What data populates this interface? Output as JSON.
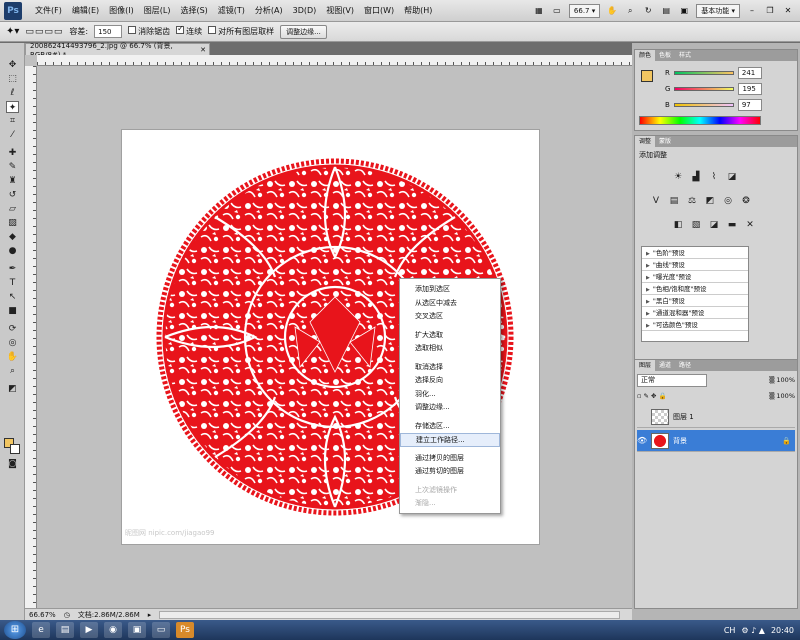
{
  "menubar": {
    "logo": "Ps",
    "items": [
      "文件(F)",
      "编辑(E)",
      "图像(I)",
      "图层(L)",
      "选择(S)",
      "滤镜(T)",
      "分析(A)",
      "3D(D)",
      "视图(V)",
      "窗口(W)",
      "帮助(H)"
    ],
    "zoom": "66.7",
    "workspace": "基本功能"
  },
  "options": {
    "tolerance_label": "容差:",
    "tolerance_value": "150",
    "antialias_label": "消除锯齿",
    "contiguous_label": "连续",
    "sample_all_label": "对所有图层取样",
    "refine_edge_button": "调整边缘..."
  },
  "document": {
    "tab_title": "200862414493796_2.jpg @ 66.7% (背景, RGB/8#) *",
    "watermark": "昵图网 nipic.com/jiagao99"
  },
  "context_menu": {
    "items": [
      {
        "label": "添加到选区",
        "state": "normal"
      },
      {
        "label": "从选区中减去",
        "state": "normal"
      },
      {
        "label": "交叉选区",
        "state": "normal"
      },
      {
        "label": "",
        "state": "sep"
      },
      {
        "label": "扩大选取",
        "state": "normal"
      },
      {
        "label": "选取相似",
        "state": "normal"
      },
      {
        "label": "",
        "state": "sep"
      },
      {
        "label": "取消选择",
        "state": "normal"
      },
      {
        "label": "选择反向",
        "state": "normal"
      },
      {
        "label": "羽化...",
        "state": "normal"
      },
      {
        "label": "调整边缘...",
        "state": "normal"
      },
      {
        "label": "",
        "state": "sep"
      },
      {
        "label": "存储选区...",
        "state": "normal"
      },
      {
        "label": "建立工作路径...",
        "state": "highlight"
      },
      {
        "label": "",
        "state": "sep"
      },
      {
        "label": "通过拷贝的图层",
        "state": "normal"
      },
      {
        "label": "通过剪切的图层",
        "state": "normal"
      },
      {
        "label": "",
        "state": "sep"
      },
      {
        "label": "上次滤镜操作",
        "state": "disabled"
      },
      {
        "label": "渐隐...",
        "state": "disabled"
      }
    ]
  },
  "statusbar": {
    "zoom": "66.67%",
    "doc_size": "文档:2.86M/2.86M"
  },
  "color_panel": {
    "tabs": [
      "颜色",
      "色板",
      "样式"
    ],
    "r_label": "R",
    "r_value": "241",
    "g_label": "G",
    "g_value": "195",
    "b_label": "B",
    "b_value": "97",
    "fg_color": "#f1c361"
  },
  "adjust_panel": {
    "tabs": [
      "调整",
      "蒙版"
    ],
    "title": "添加调整",
    "presets": [
      "\"色阶\"预设",
      "\"曲线\"预设",
      "\"曝光度\"预设",
      "\"色相/饱和度\"预设",
      "\"黑白\"预设",
      "\"通道混和器\"预设",
      "\"可选颜色\"预设"
    ]
  },
  "layers_panel": {
    "tabs": [
      "图层",
      "通道",
      "路径"
    ],
    "blend_mode": "正常",
    "opacity": "100%",
    "fill": "100%",
    "layers": [
      {
        "name": "图层 1",
        "selected": false,
        "visible": false
      },
      {
        "name": "背景",
        "selected": true,
        "visible": true
      }
    ]
  },
  "taskbar": {
    "ime": "CH",
    "time": "20:40"
  },
  "colors": {
    "papercut_red": "#e8141b",
    "accent": "#3a7dd6"
  }
}
